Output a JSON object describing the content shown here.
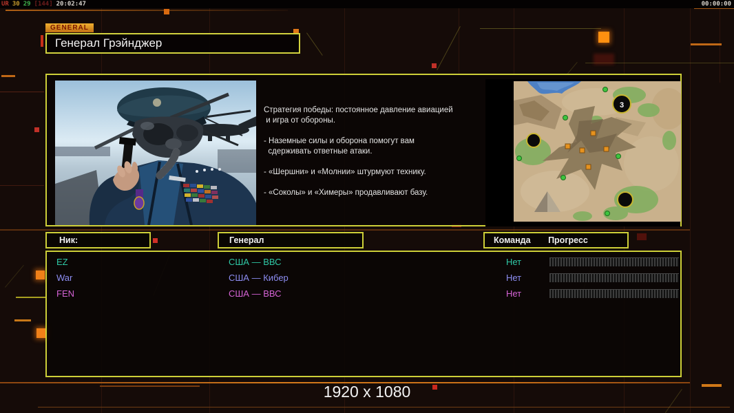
{
  "statusbar": {
    "segments": [
      {
        "text": "UR",
        "color": "#b5342a"
      },
      {
        "text": "30",
        "color": "#c49a2c"
      },
      {
        "text": "29",
        "color": "#3faf4c"
      },
      {
        "text": "[144]",
        "color": "#6e1d1d"
      },
      {
        "text": "20:02:47",
        "color": "#d6d2cc"
      }
    ],
    "timer": "00:00:00"
  },
  "header": {
    "tab": "GENERAL",
    "title": "Генерал Грэйнджер"
  },
  "briefing": {
    "text": "Стратегия победы: постоянное давление авиацией\n и игра от обороны.\n\n- Наземные силы и оборона помогут вам\n  сдерживать ответные атаки.\n\n- «Шершни» и «Молнии» штурмуют технику.\n\n- «Соколы» и «Химеры» продавливают базу."
  },
  "minimap": {
    "start_position_label": "3"
  },
  "roster": {
    "headers": {
      "nick": "Ник:",
      "general": "Генерал",
      "team": "Команда",
      "progress": "Прогресс"
    },
    "players": [
      {
        "nick": "EZ",
        "general": "США — ВВС",
        "team": "Нет",
        "color": "#2fc9a6"
      },
      {
        "nick": "War",
        "general": "США — Кибер",
        "team": "Нет",
        "color": "#8d8df2"
      },
      {
        "nick": "FEN",
        "general": "США — ВВС",
        "team": "Нет",
        "color": "#d563d5"
      }
    ]
  },
  "footer": {
    "resolution": "1920 x 1080"
  },
  "theme": {
    "border_yellow": "#cdcf38",
    "accent_orange": "#d4791a",
    "tab_text": "#7a1400"
  }
}
